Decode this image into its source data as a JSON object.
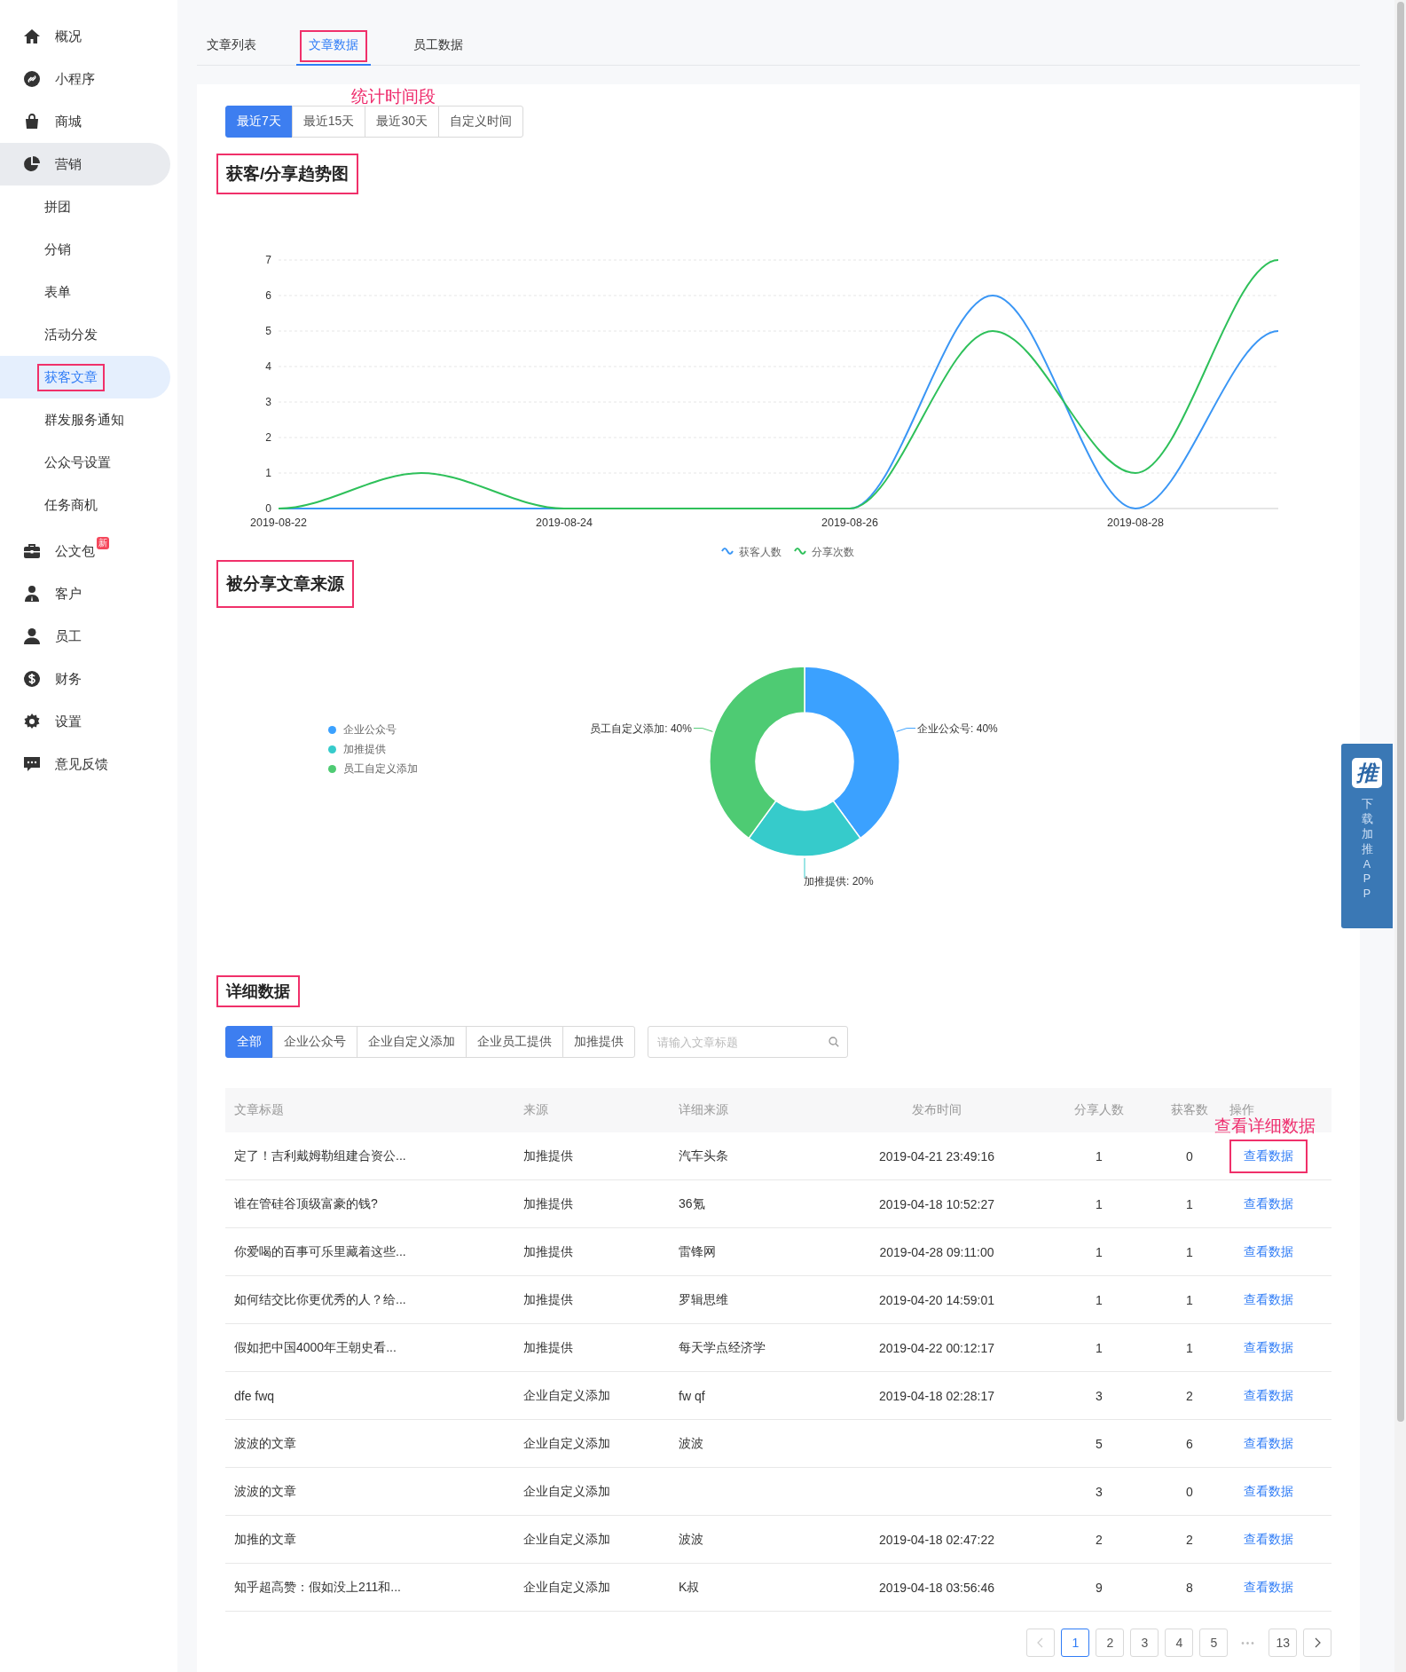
{
  "sidebar": {
    "items": [
      {
        "label": "概况",
        "selected": false
      },
      {
        "label": "小程序",
        "selected": false
      },
      {
        "label": "商城",
        "selected": false
      },
      {
        "label": "营销",
        "selected": false,
        "expanded": true,
        "children": [
          {
            "label": "拼团",
            "selected": false,
            "boxed": false
          },
          {
            "label": "分销",
            "selected": false,
            "boxed": false
          },
          {
            "label": "表单",
            "selected": false,
            "boxed": false
          },
          {
            "label": "活动分发",
            "selected": false,
            "boxed": false
          },
          {
            "label": "获客文章",
            "selected": true,
            "boxed": true
          },
          {
            "label": "群发服务通知",
            "selected": false,
            "boxed": false
          },
          {
            "label": "公众号设置",
            "selected": false,
            "boxed": false
          },
          {
            "label": "任务商机",
            "selected": false,
            "boxed": false
          }
        ]
      },
      {
        "label": "公文包",
        "selected": false,
        "badge": "新"
      },
      {
        "label": "客户",
        "selected": false
      },
      {
        "label": "员工",
        "selected": false
      },
      {
        "label": "财务",
        "selected": false
      },
      {
        "label": "设置",
        "selected": false
      },
      {
        "label": "意见反馈",
        "selected": false
      }
    ]
  },
  "tabs": [
    {
      "label": "文章列表",
      "selected": false,
      "boxed": false
    },
    {
      "label": "文章数据",
      "selected": true,
      "boxed": true
    },
    {
      "label": "员工数据",
      "selected": false,
      "boxed": false
    }
  ],
  "period": {
    "annotation": "统计时间段",
    "options": [
      {
        "label": "最近7天",
        "selected": true
      },
      {
        "label": "最近15天",
        "selected": false
      },
      {
        "label": "最近30天",
        "selected": false
      },
      {
        "label": "自定义时间",
        "selected": false
      }
    ]
  },
  "trend": {
    "title": "获客/分享趋势图",
    "boxed": true,
    "chart_data": {
      "type": "line",
      "categories": [
        "2019-08-22",
        null,
        "2019-08-24",
        null,
        "2019-08-26",
        null,
        "2019-08-28",
        null
      ],
      "ylim": [
        0,
        7
      ],
      "grid": true,
      "yticks": [
        0,
        1,
        2,
        3,
        4,
        5,
        6,
        7
      ],
      "series": [
        {
          "name": "获客人数",
          "color": "#3a96f5",
          "values": [
            0,
            0,
            0,
            0,
            0,
            6,
            0,
            5
          ]
        },
        {
          "name": "分享次数",
          "color": "#2ec05a",
          "values": [
            0,
            1,
            0,
            0,
            0,
            5,
            1,
            7
          ]
        }
      ]
    }
  },
  "sources": {
    "title": "被分享文章来源",
    "boxed": true,
    "legend": [
      {
        "label": "企业公众号",
        "color": "#3ba1ff"
      },
      {
        "label": "加推提供",
        "color": "#36cbcb"
      },
      {
        "label": "员工自定义添加",
        "color": "#4ecb73"
      }
    ],
    "chart_data": {
      "type": "donut",
      "values": [
        40,
        20,
        40
      ],
      "value_labels": [
        "企业公众号: 40%",
        "加推提供: 20%",
        "员工自定义添加: 40%"
      ]
    }
  },
  "details": {
    "title": "详细数据",
    "boxed": true,
    "filters": [
      {
        "label": "全部",
        "selected": true
      },
      {
        "label": "企业公众号",
        "selected": false
      },
      {
        "label": "企业自定义添加",
        "selected": false
      },
      {
        "label": "企业员工提供",
        "selected": false
      },
      {
        "label": "加推提供",
        "selected": false
      }
    ],
    "search": {
      "placeholder": "请输入文章标题"
    },
    "annotation": "查看详细数据",
    "table": {
      "columns": [
        "文章标题",
        "来源",
        "详细来源",
        "发布时间",
        "分享人数",
        "获客数",
        "操作"
      ],
      "rows": [
        {
          "title": "定了！吉利戴姆勒组建合资公...",
          "source": "加推提供",
          "detail": "汽车头条",
          "time": "2019-04-21 23:49:16",
          "shares": "1",
          "leads": "0",
          "action": "查看数据",
          "boxed": true
        },
        {
          "title": "谁在管硅谷顶级富豪的钱?",
          "source": "加推提供",
          "detail": "36氪",
          "time": "2019-04-18 10:52:27",
          "shares": "1",
          "leads": "1",
          "action": "查看数据",
          "boxed": false
        },
        {
          "title": "你爱喝的百事可乐里藏着这些...",
          "source": "加推提供",
          "detail": "雷锋网",
          "time": "2019-04-28 09:11:00",
          "shares": "1",
          "leads": "1",
          "action": "查看数据",
          "boxed": false
        },
        {
          "title": "如何结交比你更优秀的人？给...",
          "source": "加推提供",
          "detail": "罗辑思维",
          "time": "2019-04-20 14:59:01",
          "shares": "1",
          "leads": "1",
          "action": "查看数据",
          "boxed": false
        },
        {
          "title": "假如把中国4000年王朝史看...",
          "source": "加推提供",
          "detail": "每天学点经济学",
          "time": "2019-04-22 00:12:17",
          "shares": "1",
          "leads": "1",
          "action": "查看数据",
          "boxed": false
        },
        {
          "title": "dfe fwq",
          "source": "企业自定义添加",
          "detail": "fw qf",
          "time": "2019-04-18 02:28:17",
          "shares": "3",
          "leads": "2",
          "action": "查看数据",
          "boxed": false
        },
        {
          "title": "波波的文章",
          "source": "企业自定义添加",
          "detail": "波波",
          "shares": "5",
          "leads": "6",
          "action": "查看数据",
          "boxed": false
        },
        {
          "title": "波波的文章",
          "source": "企业自定义添加",
          "shares": "3",
          "leads": "0",
          "action": "查看数据",
          "boxed": false
        },
        {
          "title": "加推的文章",
          "source": "企业自定义添加",
          "detail": "波波",
          "time": "2019-04-18 02:47:22",
          "shares": "2",
          "leads": "2",
          "action": "查看数据",
          "boxed": false
        },
        {
          "title": "知乎超高赞：假如没上211和...",
          "source": "企业自定义添加",
          "detail": "K叔",
          "time": "2019-04-18 03:56:46",
          "shares": "9",
          "leads": "8",
          "action": "查看数据",
          "boxed": false
        }
      ]
    },
    "pagination": {
      "pages": [
        {
          "label": "1",
          "selected": true
        },
        {
          "label": "2",
          "selected": false
        },
        {
          "label": "3",
          "selected": false
        },
        {
          "label": "4",
          "selected": false
        },
        {
          "label": "5",
          "selected": false
        }
      ],
      "ellipsis": "•••",
      "last": {
        "label": "13",
        "selected": false
      }
    }
  },
  "float_panel": {
    "logo": "推",
    "text": "下载加推APP"
  }
}
